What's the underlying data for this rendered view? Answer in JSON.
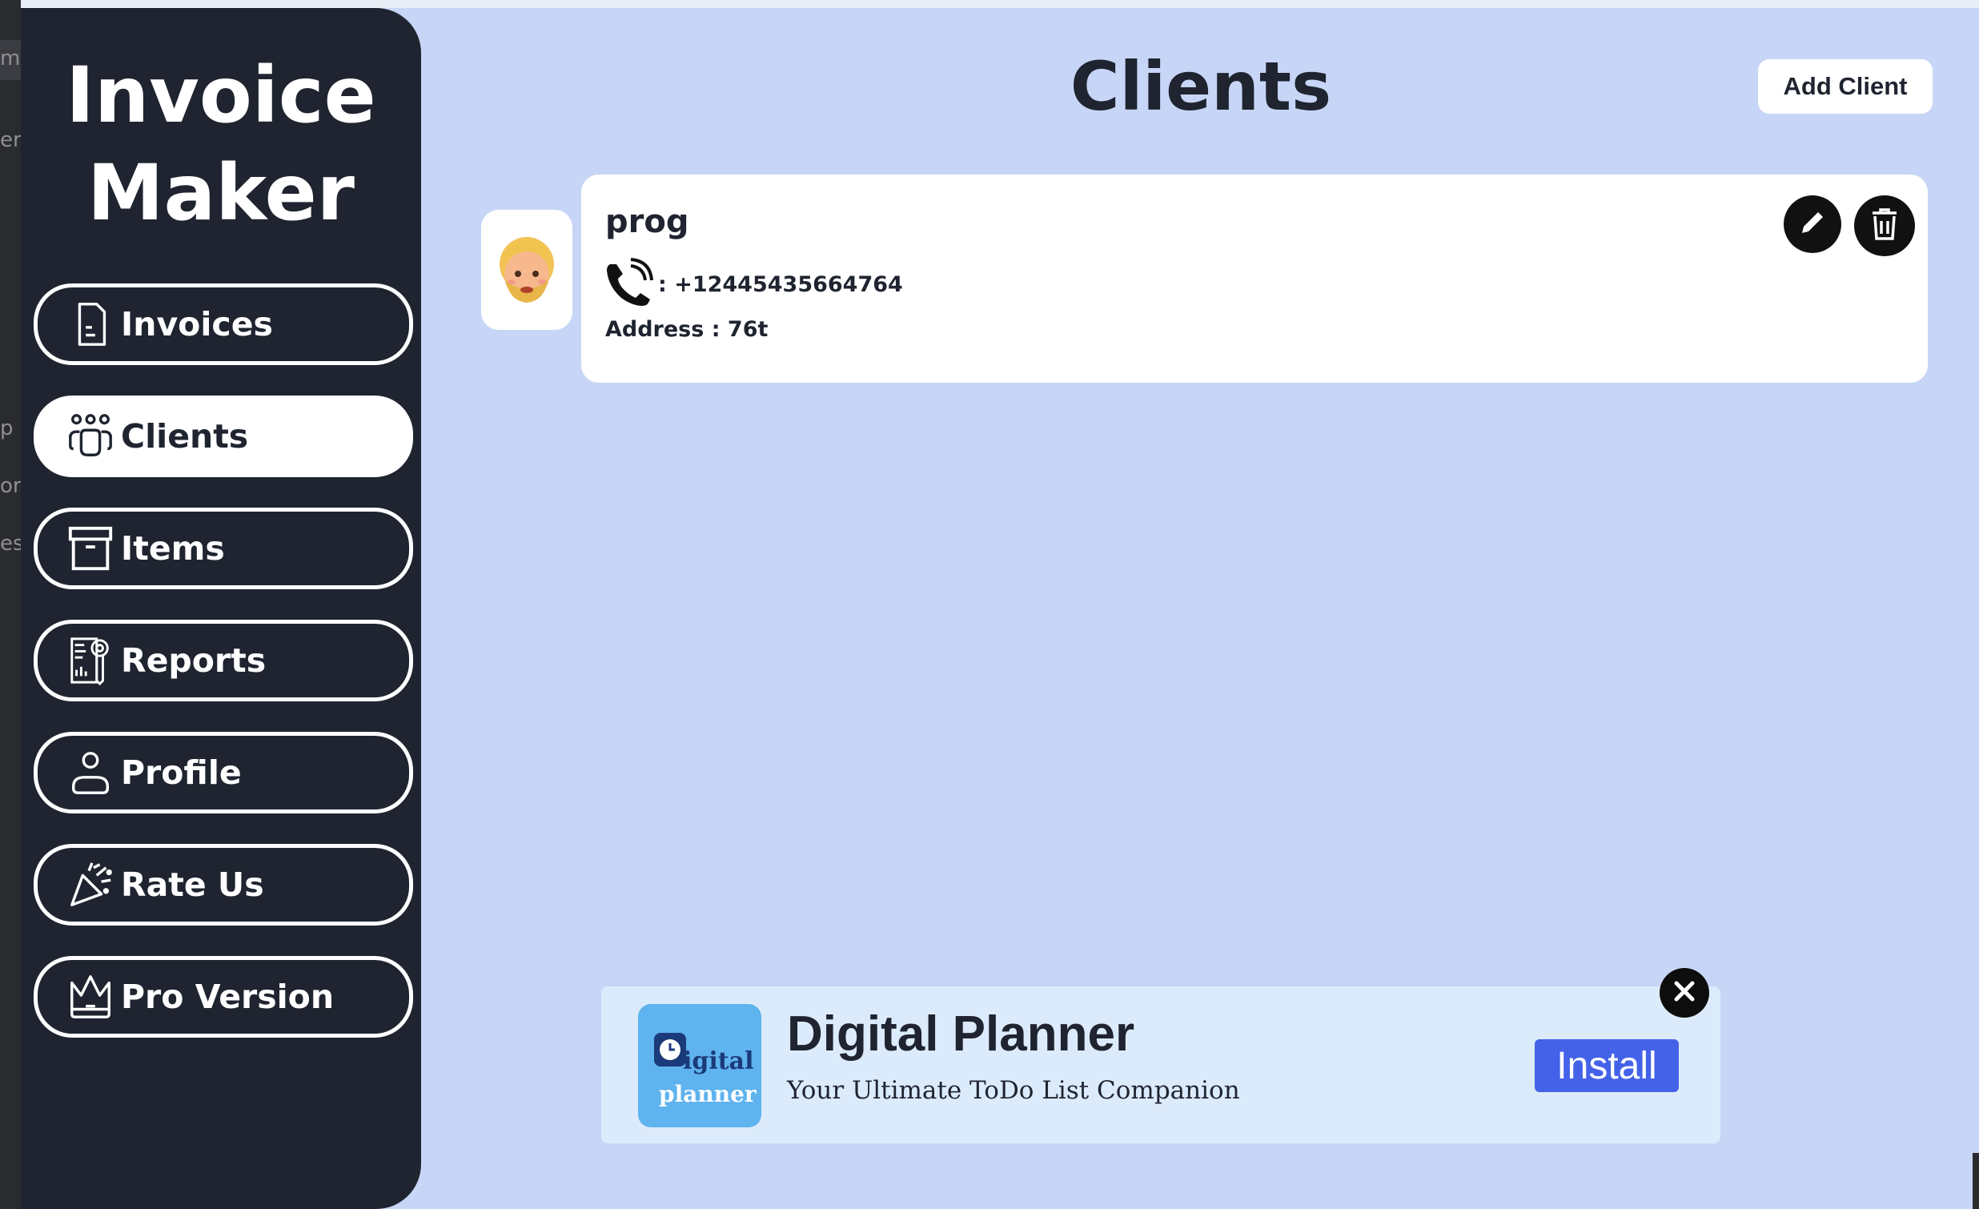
{
  "edge_window": {
    "fragments": [
      "ma",
      "er",
      "p",
      "ori",
      "es"
    ]
  },
  "sidebar": {
    "logo_line1": "Invoice",
    "logo_line2": "Maker",
    "items": [
      {
        "label": "Invoices",
        "icon": "invoice-icon",
        "active": false
      },
      {
        "label": "Clients",
        "icon": "clients-icon",
        "active": true
      },
      {
        "label": "Items",
        "icon": "box-icon",
        "active": false
      },
      {
        "label": "Reports",
        "icon": "report-icon",
        "active": false
      },
      {
        "label": "Profile",
        "icon": "user-icon",
        "active": false
      },
      {
        "label": "Rate Us",
        "icon": "party-popper-icon",
        "active": false
      },
      {
        "label": "Pro Version",
        "icon": "crown-icon",
        "active": false
      }
    ]
  },
  "header": {
    "title": "Clients",
    "add_client_label": "Add Client"
  },
  "clients": [
    {
      "name": "prog",
      "phone": ": +12445435664764",
      "address": "Address : 76t",
      "avatar": "face-emoji"
    }
  ],
  "ad": {
    "logo_text1": "igital",
    "logo_text2": "planner",
    "title": "Digital Planner",
    "subtitle": "Your Ultimate ToDo List Companion",
    "install_label": "Install"
  },
  "colors": {
    "background": "#c7d6f7",
    "sidebar": "#1f2430",
    "card": "#ffffff",
    "install": "#4462e8"
  }
}
